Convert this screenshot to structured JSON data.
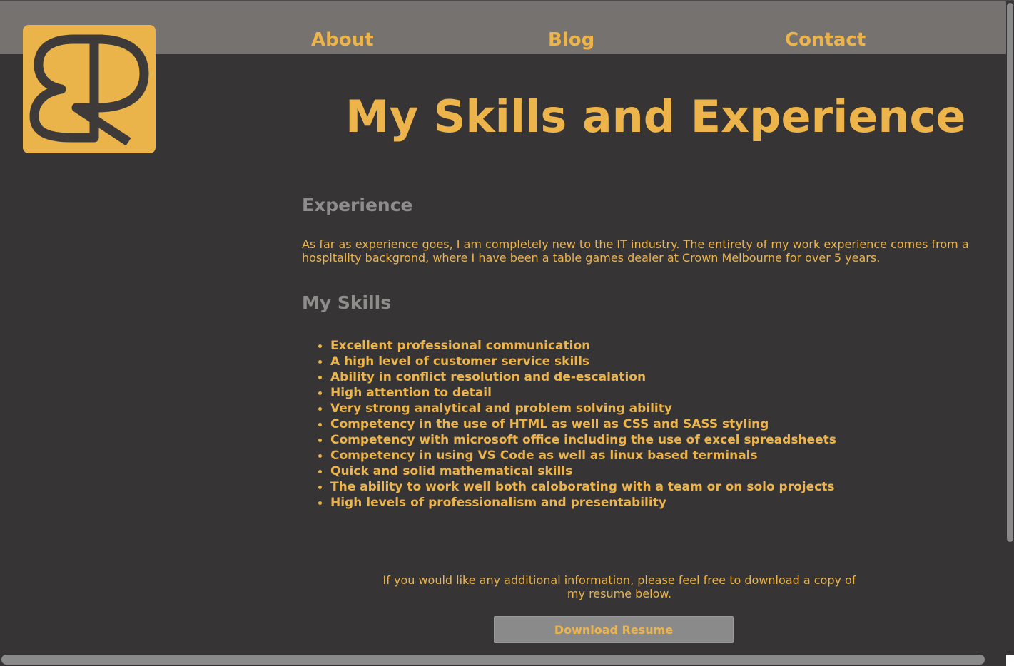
{
  "nav": {
    "links": [
      {
        "label": "About"
      },
      {
        "label": "Blog"
      },
      {
        "label": "Contact"
      }
    ]
  },
  "logo": {
    "icon": "br-monogram-logo"
  },
  "page": {
    "title": "My Skills and Experience",
    "experience": {
      "heading": "Experience",
      "text": "As far as experience goes, I am completely new to the IT industry. The entirety of my work experience comes from a hospitality backgrond, where I have been a table games dealer at Crown Melbourne for over 5 years."
    },
    "skills": {
      "heading": "My Skills",
      "items": [
        "Excellent professional communication",
        "A high level of customer service skills",
        "Ability in conflict resolution and de-escalation",
        "High attention to detail",
        "Very strong analytical and problem solving ability",
        "Competency in the use of HTML as well as CSS and SASS styling",
        "Competency with microsoft office including the use of excel spreadsheets",
        "Competency in using VS Code as well as linux based terminals",
        "Quick and solid mathematical skills",
        "The ability to work well both caloborating with a team or on solo projects",
        "High levels of professionalism and presentability"
      ]
    },
    "resume": {
      "note": "If you would like any additional information, please feel free to download a copy of my resume below.",
      "button_label": "Download Resume"
    }
  },
  "colors": {
    "accent": "#ecb44b",
    "background": "#363435",
    "navbar": "#767270",
    "heading_grey": "#8f8d8c",
    "button": "#8a8a8a"
  }
}
